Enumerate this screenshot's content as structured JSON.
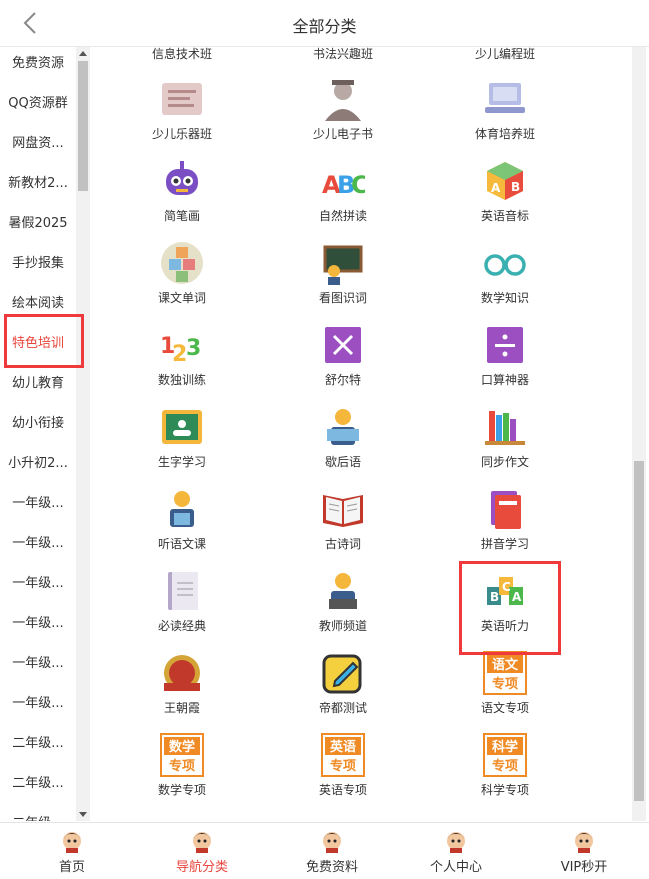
{
  "header": {
    "title": "全部分类"
  },
  "sidebar": {
    "items": [
      {
        "label": "免费资源"
      },
      {
        "label": "QQ资源群"
      },
      {
        "label": "网盘资..."
      },
      {
        "label": "新教材2..."
      },
      {
        "label": "暑假2025"
      },
      {
        "label": "手抄报集"
      },
      {
        "label": "绘本阅读"
      },
      {
        "label": "特色培训",
        "active": true
      },
      {
        "label": "幼儿教育"
      },
      {
        "label": "幼小衔接"
      },
      {
        "label": "小升初2..."
      },
      {
        "label": "一年级..."
      },
      {
        "label": "一年级..."
      },
      {
        "label": "一年级..."
      },
      {
        "label": "一年级..."
      },
      {
        "label": "一年级..."
      },
      {
        "label": "一年级..."
      },
      {
        "label": "二年级..."
      },
      {
        "label": "二年级..."
      },
      {
        "label": "二年级..."
      }
    ]
  },
  "grid": {
    "items": [
      {
        "label": "信息技术班",
        "icon": "info-tech-icon"
      },
      {
        "label": "书法兴趣班",
        "icon": "calligraphy-icon"
      },
      {
        "label": "少儿编程班",
        "icon": "coding-icon"
      },
      {
        "label": "少儿乐器班",
        "icon": "instrument-icon"
      },
      {
        "label": "少儿电子书",
        "icon": "ebook-reader-icon"
      },
      {
        "label": "体育培养班",
        "icon": "laptop-icon"
      },
      {
        "label": "简笔画",
        "icon": "robot-icon"
      },
      {
        "label": "自然拼读",
        "icon": "abc-letters-icon"
      },
      {
        "label": "英语音标",
        "icon": "abc-cube-icon"
      },
      {
        "label": "课文单词",
        "icon": "abc-blocks-icon"
      },
      {
        "label": "看图识词",
        "icon": "blackboard-teacher-icon"
      },
      {
        "label": "数学知识",
        "icon": "glasses-icon"
      },
      {
        "label": "数独训练",
        "icon": "numbers-123-icon"
      },
      {
        "label": "舒尔特",
        "icon": "multiply-icon"
      },
      {
        "label": "口算神器",
        "icon": "divide-icon"
      },
      {
        "label": "生字学习",
        "icon": "classroom-board-icon"
      },
      {
        "label": "歇后语",
        "icon": "reader-icon"
      },
      {
        "label": "同步作文",
        "icon": "bookshelf-icon"
      },
      {
        "label": "听语文课",
        "icon": "student-icon"
      },
      {
        "label": "古诗词",
        "icon": "open-book-icon"
      },
      {
        "label": "拼音学习",
        "icon": "red-book-icon"
      },
      {
        "label": "必读经典",
        "icon": "notebook-icon"
      },
      {
        "label": "教师频道",
        "icon": "teacher-laptop-icon"
      },
      {
        "label": "英语听力",
        "icon": "bca-cubes-icon"
      },
      {
        "label": "王朝霞",
        "icon": "badge-logo-icon"
      },
      {
        "label": "帝都测试",
        "icon": "edit-pencil-icon"
      },
      {
        "label": "语文专项",
        "icon": "chinese-special-icon",
        "badge": [
          "语文",
          "专项"
        ]
      },
      {
        "label": "数学专项",
        "icon": "math-special-icon",
        "badge": [
          "数学",
          "专项"
        ]
      },
      {
        "label": "英语专项",
        "icon": "english-special-icon",
        "badge": [
          "英语",
          "专项"
        ]
      },
      {
        "label": "科学专项",
        "icon": "science-special-icon",
        "badge": [
          "科学",
          "专项"
        ]
      }
    ]
  },
  "tabbar": {
    "tabs": [
      {
        "label": "首页"
      },
      {
        "label": "导航分类",
        "active": true
      },
      {
        "label": "免费资料"
      },
      {
        "label": "个人中心"
      },
      {
        "label": "VIP秒开"
      }
    ]
  },
  "colors": {
    "active": "#e8453c",
    "highlight": "#f0393a",
    "badge_orange": "#f08a24"
  }
}
